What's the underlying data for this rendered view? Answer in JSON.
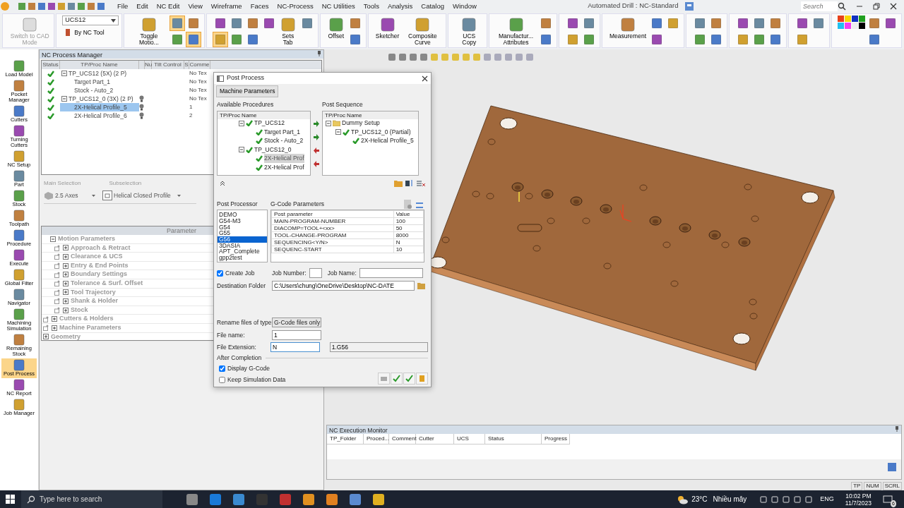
{
  "titlebar": {
    "menu": [
      "File",
      "Edit",
      "NC Edit",
      "View",
      "Wireframe",
      "Faces",
      "NC-Process",
      "NC Utilities",
      "Tools",
      "Analysis",
      "Catalog",
      "Window"
    ],
    "title": "Automated Drill : NC-Standard",
    "search": {
      "placeholder": "Search"
    }
  },
  "ribbon": [
    {
      "items": [
        {
          "kind": "large",
          "label": "Switch to CAD Mode",
          "disabled": true
        }
      ]
    },
    {
      "items": [
        {
          "kind": "combo",
          "value": "UCS12"
        },
        {
          "kind": "small",
          "label": "By NC Tool"
        }
      ]
    },
    {
      "items": [
        {
          "kind": "large",
          "label": "Toggle Motio...",
          "disabled": false
        },
        {
          "kind": "tool",
          "on": true
        },
        {
          "kind": "tool",
          "on": false
        },
        {
          "kind": "tool",
          "on": false
        },
        {
          "kind": "tool",
          "on": true
        }
      ]
    },
    {
      "items": [
        {
          "kind": "tool",
          "on": false
        },
        {
          "kind": "tool",
          "on": true
        },
        {
          "kind": "tool",
          "on": false
        },
        {
          "kind": "tool",
          "on": false
        },
        {
          "kind": "tool",
          "on": false
        },
        {
          "kind": "tool",
          "on": false
        },
        {
          "kind": "tool",
          "on": false
        },
        {
          "kind": "large",
          "label": "Sets Tab",
          "disabled": false
        },
        {
          "kind": "tool",
          "on": false
        }
      ]
    },
    {
      "items": [
        {
          "kind": "large",
          "label": "Offset",
          "disabled": false
        },
        {
          "kind": "tool",
          "on": false
        },
        {
          "kind": "tool",
          "on": false
        }
      ]
    },
    {
      "items": [
        {
          "kind": "large",
          "label": "Sketcher",
          "disabled": false
        },
        {
          "kind": "large",
          "label": "Composite Curve",
          "disabled": false
        }
      ]
    },
    {
      "items": [
        {
          "kind": "large",
          "label": "UCS Copy",
          "disabled": false
        }
      ]
    },
    {
      "items": [
        {
          "kind": "large",
          "label": "Manufactur... Attributes",
          "disabled": false
        },
        {
          "kind": "tool",
          "on": false
        },
        {
          "kind": "tool",
          "on": false
        }
      ]
    },
    {
      "items": [
        {
          "kind": "tool",
          "on": false
        },
        {
          "kind": "tool",
          "on": false
        },
        {
          "kind": "tool",
          "on": false
        },
        {
          "kind": "tool",
          "on": false
        }
      ]
    },
    {
      "items": [
        {
          "kind": "large",
          "label": "Measurement",
          "disabled": false
        },
        {
          "kind": "tool",
          "on": false
        },
        {
          "kind": "tool",
          "on": false
        },
        {
          "kind": "tool",
          "on": false
        }
      ]
    },
    {
      "items": [
        {
          "kind": "tool",
          "on": false
        },
        {
          "kind": "tool",
          "on": false
        },
        {
          "kind": "tool",
          "on": false
        },
        {
          "kind": "tool",
          "on": false
        }
      ]
    },
    {
      "items": [
        {
          "kind": "tool",
          "on": false
        },
        {
          "kind": "tool",
          "on": false
        },
        {
          "kind": "tool",
          "on": false
        },
        {
          "kind": "tool",
          "on": false
        },
        {
          "kind": "tool",
          "on": false
        },
        {
          "kind": "tool",
          "on": false
        }
      ]
    },
    {
      "items": [
        {
          "kind": "tool",
          "on": false
        },
        {
          "kind": "tool",
          "on": false
        },
        {
          "kind": "tool",
          "on": false
        }
      ]
    },
    {
      "items": [
        {
          "kind": "palette",
          "on": false
        },
        {
          "kind": "tool",
          "on": false
        },
        {
          "kind": "tool",
          "on": false
        },
        {
          "kind": "tool",
          "on": false
        }
      ]
    }
  ],
  "left_toolbar": [
    {
      "label": "Load Model",
      "selected": false
    },
    {
      "label": "Pocket Manager",
      "selected": false
    },
    {
      "label": "Cutters",
      "selected": false
    },
    {
      "label": "Turning Cutters",
      "selected": false
    },
    {
      "label": "NC Setup",
      "selected": false
    },
    {
      "label": "Part",
      "selected": false
    },
    {
      "label": "Stock",
      "selected": false
    },
    {
      "label": "Toolpath",
      "selected": false
    },
    {
      "label": "Procedure",
      "selected": false
    },
    {
      "label": "Execute",
      "selected": false
    },
    {
      "label": "Global Filter",
      "selected": false
    },
    {
      "label": "Navigator",
      "selected": false
    },
    {
      "label": "Machining Simulation",
      "selected": false
    },
    {
      "label": "Remaining Stock",
      "selected": false
    },
    {
      "label": "Post Process",
      "selected": true
    },
    {
      "label": "NC Report",
      "selected": false
    },
    {
      "label": "Job Manager",
      "selected": false
    }
  ],
  "process_manager": {
    "title": "NC Process Manager",
    "columns": [
      "Status",
      "TP/Proc Name",
      "Nu",
      "Tilt Control",
      "S",
      "Comme"
    ],
    "rows": [
      {
        "name": "TP_UCS12 (5X) (2 P)",
        "comment": "No Tex",
        "light": false,
        "selected": false,
        "expanded": true,
        "children": [
          {
            "name": "Target Part_1",
            "comment": "No Tex",
            "light": false,
            "selected": false
          },
          {
            "name": "Stock - Auto_2",
            "comment": "No Tex",
            "light": false,
            "selected": false
          }
        ]
      },
      {
        "name": "TP_UCS12_0 (3X) (2 P)",
        "comment": "No Tex",
        "light": true,
        "selected": false,
        "expanded": true,
        "children": [
          {
            "name": "2X-Helical Profile_5",
            "comment": "1",
            "light": true,
            "selected": true
          },
          {
            "name": "2X-Helical Profile_6",
            "comment": "2",
            "light": true,
            "selected": false
          }
        ]
      }
    ]
  },
  "selection": {
    "main": {
      "label": "Main Selection",
      "value": "2.5 Axes"
    },
    "sub": {
      "label": "Subselection",
      "value": "Helical Closed Profile"
    }
  },
  "parameters": {
    "header": "Parameter",
    "tree": [
      {
        "label": "Motion Parameters",
        "expanded": true,
        "children": [
          {
            "label": "Approach & Retract",
            "expanded": false
          },
          {
            "label": "Clearance & UCS",
            "expanded": false
          },
          {
            "label": "Entry & End Points",
            "expanded": false
          },
          {
            "label": "Boundary Settings",
            "expanded": false
          },
          {
            "label": "Tolerance & Surf. Offset",
            "expanded": false
          },
          {
            "label": "Tool Trajectory",
            "expanded": false
          },
          {
            "label": "Shank & Holder",
            "expanded": false
          },
          {
            "label": "Stock",
            "expanded": false
          }
        ]
      },
      {
        "label": "Cutters & Holders",
        "expanded": false
      },
      {
        "label": "Machine Parameters",
        "expanded": false
      },
      {
        "label": "Geometry",
        "expanded": false
      }
    ]
  },
  "dialog": {
    "title": "Post Process",
    "tab": "Machine Parameters",
    "available": {
      "label": "Available Procedures",
      "header": "TP/Proc Name",
      "tree": [
        {
          "name": "TP_UCS12",
          "selected": false,
          "expanded": true,
          "children": [
            {
              "name": "Target Part_1",
              "selected": false
            },
            {
              "name": "Stock - Auto_2",
              "selected": false
            }
          ]
        },
        {
          "name": "TP_UCS12_0",
          "selected": false,
          "expanded": true,
          "children": [
            {
              "name": "2X-Helical Prof",
              "selected": true
            },
            {
              "name": "2X-Helical Prof",
              "selected": false
            }
          ]
        }
      ]
    },
    "sequence": {
      "label": "Post Sequence",
      "header": "TP/Proc Name",
      "tree": [
        {
          "name": "Dummy Setup",
          "kind": "folder",
          "expanded": true,
          "children": [
            {
              "name": "TP_UCS12_0 (Partial)",
              "kind": "toolpath",
              "expanded": true,
              "children": [
                {
                  "name": "2X-Helical Profile_5",
                  "kind": "toolpath"
                }
              ]
            }
          ]
        }
      ]
    },
    "post_processor": {
      "label": "Post Processor",
      "items": [
        {
          "label": "DEMO",
          "selected": false
        },
        {
          "label": "G54-M3",
          "selected": false
        },
        {
          "label": "G54",
          "selected": false
        },
        {
          "label": "G55",
          "selected": false
        },
        {
          "label": "G56",
          "selected": true
        },
        {
          "label": "3DASIA",
          "selected": false
        },
        {
          "label": "APT_Complete",
          "selected": false
        },
        {
          "label": "gpp2test",
          "selected": false
        }
      ]
    },
    "gcode": {
      "label": "G-Code Parameters",
      "columns": [
        "Post parameter",
        "Value"
      ],
      "rows": [
        [
          "MAIN-PROGRAM-NUMBER",
          "100"
        ],
        [
          "DIACOMP=TOOL+<xx>",
          "50"
        ],
        [
          "TOOL-CHANGE-PROGRAM",
          "8000"
        ],
        [
          "SEQUENCING<Y/N>",
          "N"
        ],
        [
          "SEQUENC-START",
          "10"
        ]
      ]
    },
    "create_job": {
      "label": "Create Job",
      "checked": true
    },
    "job_number": {
      "label": "Job Number:"
    },
    "job_name": {
      "label": "Job Name:"
    },
    "destination": {
      "label": "Destination Folder",
      "value": "C:\\Users\\chung\\OneDrive\\Desktop\\NC-DATE"
    },
    "rename": {
      "label": "Rename files of type:",
      "value": "G-Code files only"
    },
    "file_name": {
      "label": "File name:",
      "value": "1"
    },
    "file_extension": {
      "label": "File Extension:",
      "value": "N",
      "result": "1.G56"
    },
    "after": {
      "label": "After Completion",
      "options": [
        {
          "label": "Display G-Code",
          "checked": true
        },
        {
          "label": "Keep Simulation Data",
          "checked": false
        }
      ]
    }
  },
  "monitor": {
    "title": "NC Execution Monitor",
    "columns": [
      "TP_Folder",
      "Proced...",
      "Comment",
      "Cutter",
      "UCS",
      "Status",
      "Progress"
    ]
  },
  "status_bar": [
    "TP",
    "NUM",
    "SCRL"
  ],
  "taskbar": {
    "search": {
      "placeholder": "Type here to search"
    },
    "temperature": "23°C",
    "weather": "Nhiều mây",
    "language": "ENG",
    "time": "10:02 PM",
    "date": "11/7/2023",
    "notifications": "6"
  }
}
